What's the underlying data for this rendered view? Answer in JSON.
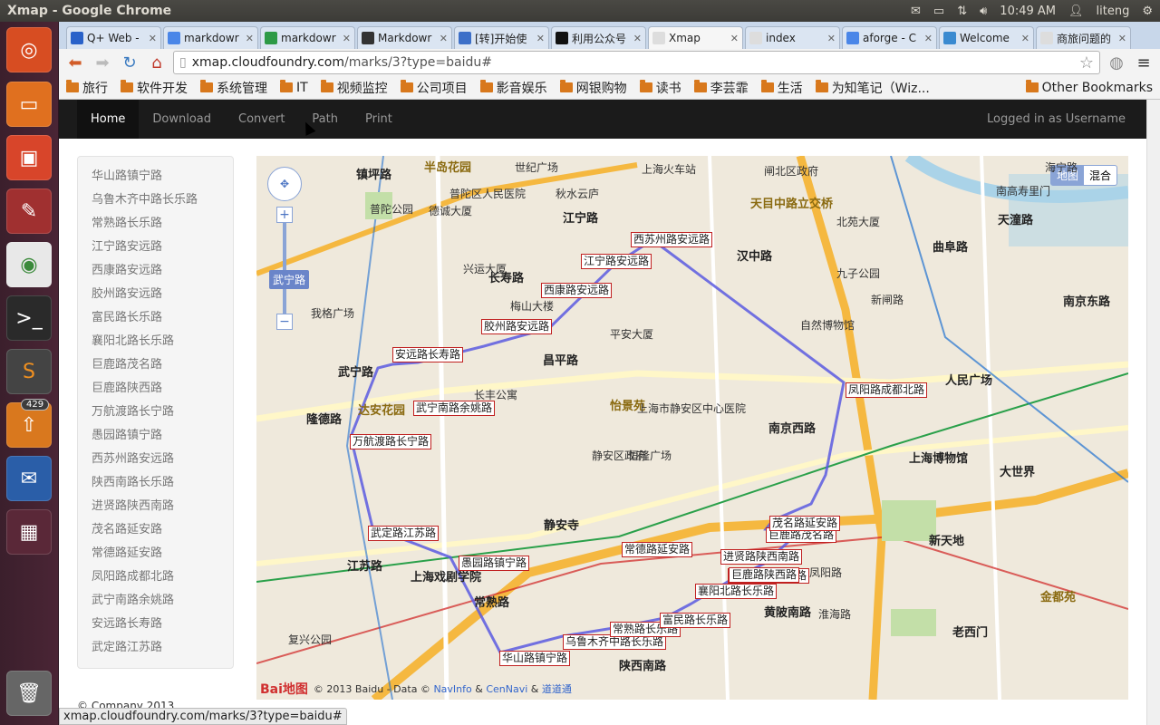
{
  "os": {
    "window_title": "Xmap - Google Chrome",
    "clock": "10:49 AM",
    "user": "liteng",
    "launcher_badge": "429"
  },
  "browser": {
    "tabs": [
      {
        "label": "Q+ Web -",
        "color": "#2a62c9",
        "active": false
      },
      {
        "label": "markdowr",
        "color": "#4a86e8",
        "active": false
      },
      {
        "label": "markdowr",
        "color": "#2d9a46",
        "active": false
      },
      {
        "label": "Markdowr",
        "color": "#333333",
        "active": false
      },
      {
        "label": "[转]开始使",
        "color": "#3c6fc8",
        "active": false
      },
      {
        "label": "利用公众号",
        "color": "#111111",
        "active": false
      },
      {
        "label": "Xmap",
        "color": "#dddddd",
        "active": true
      },
      {
        "label": "index",
        "color": "#dddddd",
        "active": false
      },
      {
        "label": "aforge - C",
        "color": "#4a86e8",
        "active": false
      },
      {
        "label": "Welcome",
        "color": "#3a8ad0",
        "active": false
      },
      {
        "label": "商旅问题的",
        "color": "#dddddd",
        "active": false
      }
    ],
    "url_host": "xmap.cloudfoundry.com",
    "url_path": "/marks/3?type=baidu#",
    "bookmarks": [
      "旅行",
      "软件开发",
      "系统管理",
      "IT",
      "视频监控",
      "公司项目",
      "影音娱乐",
      "网银购物",
      "读书",
      "李芸霏",
      "生活",
      "为知笔记（Wiz...",
      "Other Bookmarks"
    ],
    "status_url": "xmap.cloudfoundry.com/marks/3?type=baidu#"
  },
  "navbar": {
    "items": [
      "Home",
      "Download",
      "Convert",
      "Path",
      "Print"
    ],
    "active": "Home",
    "login": "Logged in as Username"
  },
  "sidebar": {
    "items": [
      "华山路镇宁路",
      "乌鲁木齐中路长乐路",
      "常熟路长乐路",
      "江宁路安远路",
      "西康路安远路",
      "胶州路安远路",
      "富民路长乐路",
      "襄阳北路长乐路",
      "巨鹿路茂名路",
      "巨鹿路陕西路",
      "万航渡路长宁路",
      "愚园路镇宁路",
      "西苏州路安远路",
      "陕西南路长乐路",
      "进贤路陕西南路",
      "茂名路延安路",
      "常德路延安路",
      "凤阳路成都北路",
      "武宁南路余姚路",
      "安远路长寿路",
      "武定路江苏路"
    ]
  },
  "footer": "© Company 2013",
  "map": {
    "type_buttons": [
      "地图",
      "混合"
    ],
    "zoom_label": "武宁路",
    "copyright": "© 2013 Baidu - Data ©",
    "copyright_links": [
      "NavInfo",
      "CenNavi",
      "道道通"
    ],
    "logo": "Bai地图",
    "markers": [
      {
        "label": "西苏州路安远路"
      },
      {
        "label": "江宁路安远路"
      },
      {
        "label": "西康路安远路"
      },
      {
        "label": "胶州路安远路"
      },
      {
        "label": "安远路长寿路"
      },
      {
        "label": "武宁南路余姚路"
      },
      {
        "label": "万航渡路长宁路"
      },
      {
        "label": "武定路江苏路"
      },
      {
        "label": "愚园路镇宁路"
      },
      {
        "label": "华山路镇宁路"
      },
      {
        "label": "乌鲁木齐中路长乐路"
      },
      {
        "label": "常熟路长乐路"
      },
      {
        "label": "富民路长乐路"
      },
      {
        "label": "襄阳北路长乐路"
      },
      {
        "label": "陕西南路长乐路"
      },
      {
        "label": "进贤路陕西南路"
      },
      {
        "label": "巨鹿路陕西路"
      },
      {
        "label": "巨鹿路茂名路"
      },
      {
        "label": "茂名路延安路"
      },
      {
        "label": "常德路延安路"
      },
      {
        "label": "凤阳路成都北路"
      }
    ],
    "places": [
      "镇坪路",
      "半岛花园",
      "世纪广场",
      "上海火车站",
      "闸北区政府",
      "海宁路",
      "普陀区人民医院",
      "秋水云庐",
      "江宁路",
      "天目中路立交桥",
      "南高寿里门",
      "天潼路",
      "普陀公园",
      "德诚大厦",
      "北苑大厦",
      "曲阜路",
      "兴运大厦",
      "长寿路",
      "梅山大楼",
      "汉中路",
      "九子公园",
      "新闸路",
      "南京东路",
      "自然博物馆",
      "昌平路",
      "平安大厦",
      "我格广场",
      "武宁路",
      "隆德路",
      "达安花园",
      "长丰公寓",
      "怡景苑",
      "上海市静安区中心医院",
      "南京西路",
      "人民广场",
      "上海博物馆",
      "大世界",
      "静安区政府",
      "恒隆广场",
      "静安寺",
      "江苏路",
      "上海戏剧学院",
      "常熟路",
      "陕西南路",
      "黄陂南路",
      "新天地",
      "老西门",
      "金都苑",
      "复兴公园",
      "淮海路",
      "凤阳路"
    ]
  }
}
